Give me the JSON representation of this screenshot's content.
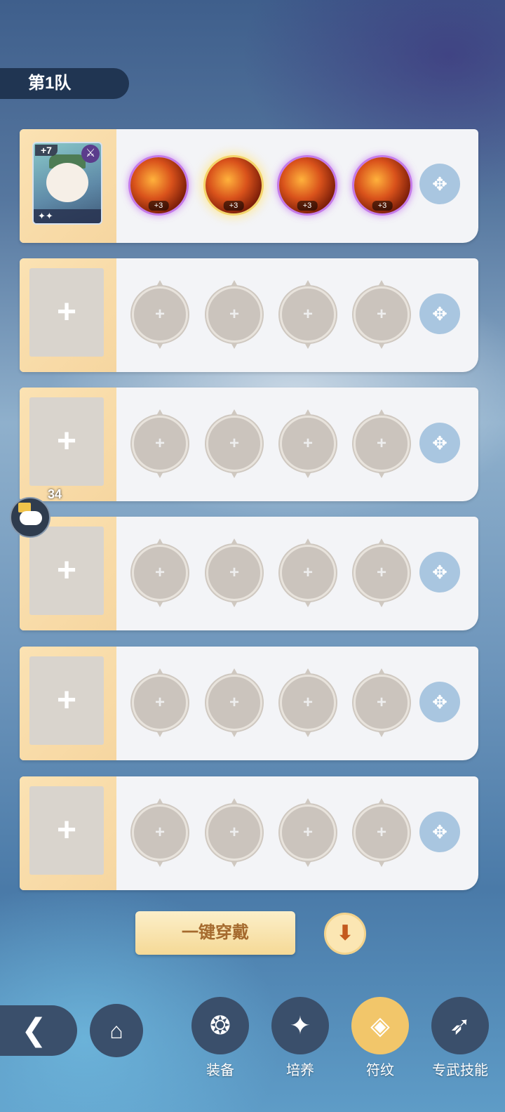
{
  "team_tab": {
    "label": "第1队"
  },
  "hero": {
    "level": "+7",
    "class_icon": "dagger-icon",
    "stars": "✦✦"
  },
  "rune_level_label": "+3",
  "one_key_equip": {
    "label": "一键穿戴"
  },
  "chat": {
    "count": "34"
  },
  "bottom_nav": {
    "equipment": "装备",
    "train": "培养",
    "rune": "符纹",
    "exclusive_skill": "专武技能"
  },
  "colors": {
    "accent_gold": "#f2c66a",
    "rune_purple": "#c47ae8",
    "panel": "#f3f4f7"
  }
}
